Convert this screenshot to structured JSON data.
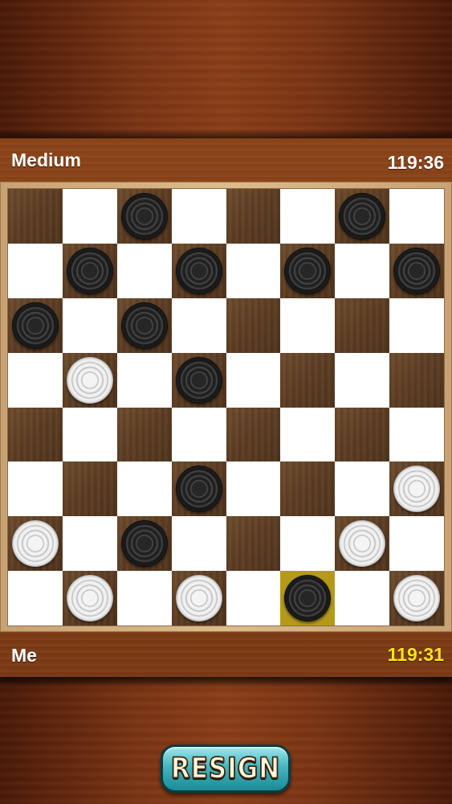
{
  "opponent": {
    "name": "Medium",
    "timer": "119:36"
  },
  "player": {
    "name": "Me",
    "timer": "119:31"
  },
  "resign_label": "RESIGN",
  "colors": {
    "player_timer": "#ffe31a",
    "highlight": "#b59a1a"
  },
  "board": [
    [
      "",
      "",
      "b",
      "",
      "",
      "",
      "b",
      ""
    ],
    [
      "",
      "b",
      "",
      "b",
      "",
      "b",
      "",
      "b"
    ],
    [
      "b",
      "",
      "b",
      "",
      "",
      "",
      "",
      ""
    ],
    [
      "",
      "w",
      "",
      "b",
      "",
      "",
      "",
      ""
    ],
    [
      "",
      "",
      "",
      "",
      "",
      "",
      "",
      ""
    ],
    [
      "",
      "",
      "",
      "b",
      "",
      "",
      "",
      "w"
    ],
    [
      "w",
      "",
      "b",
      "",
      "",
      "",
      "w",
      ""
    ],
    [
      "",
      "w",
      "",
      "w",
      "",
      "b",
      "",
      "w"
    ]
  ],
  "highlighted_square": [
    7,
    5
  ]
}
